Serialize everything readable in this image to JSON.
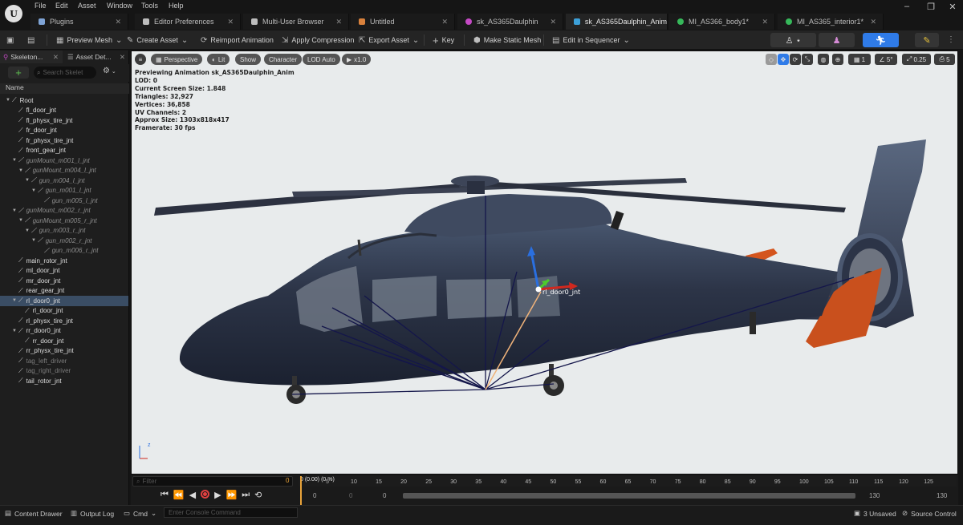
{
  "menu": [
    "File",
    "Edit",
    "Asset",
    "Window",
    "Tools",
    "Help"
  ],
  "tabs": [
    {
      "label": "Plugins",
      "icon": "plugin-icon",
      "color": "#7fa4d6"
    },
    {
      "label": "Editor Preferences",
      "icon": "sliders-icon",
      "color": "#bdbdbd"
    },
    {
      "label": "Multi-User Browser",
      "icon": "monitor-icon",
      "color": "#bdbdbd"
    },
    {
      "label": "Untitled",
      "icon": "level-icon",
      "color": "#d9813c"
    },
    {
      "label": "sk_AS365Daulphin",
      "icon": "skeleton-icon",
      "color": "#c64ac6"
    },
    {
      "label": "sk_AS365Daulphin_Anim",
      "icon": "animation-icon",
      "color": "#3ca0d9"
    },
    {
      "label": "MI_AS366_body1*",
      "icon": "material-icon",
      "color": "#36b85a"
    },
    {
      "label": "MI_AS365_interior1*",
      "icon": "material-icon",
      "color": "#36b85a"
    }
  ],
  "toolbar": {
    "preview_mesh": "Preview Mesh",
    "create_asset": "Create Asset",
    "reimport_animation": "Reimport Animation",
    "apply_compression": "Apply Compression",
    "export_asset": "Export Asset",
    "key": "Key",
    "make_static_mesh": "Make Static Mesh",
    "edit_in_sequencer": "Edit in Sequencer"
  },
  "left_panel": {
    "tab_skeleton": "Skeleton...",
    "tab_asset_details": "Asset Det...",
    "search_placeholder": "Search Skelet",
    "column_name": "Name",
    "bones": [
      {
        "label": "Root",
        "depth": 0,
        "arrow": true,
        "style": "normal"
      },
      {
        "label": "fl_door_jnt",
        "depth": 1,
        "arrow": false,
        "style": "normal"
      },
      {
        "label": "fl_physx_tire_jnt",
        "depth": 1,
        "arrow": false,
        "style": "normal"
      },
      {
        "label": "fr_door_jnt",
        "depth": 1,
        "arrow": false,
        "style": "normal"
      },
      {
        "label": "fr_physx_tire_jnt",
        "depth": 1,
        "arrow": false,
        "style": "normal"
      },
      {
        "label": "front_gear_jnt",
        "depth": 1,
        "arrow": false,
        "style": "normal"
      },
      {
        "label": "gunMount_m001_l_jnt",
        "depth": 1,
        "arrow": true,
        "style": "dim"
      },
      {
        "label": "gunMount_m004_l_jnt",
        "depth": 2,
        "arrow": true,
        "style": "dim"
      },
      {
        "label": "gun_m004_l_jnt",
        "depth": 3,
        "arrow": true,
        "style": "dim"
      },
      {
        "label": "gun_m001_l_jnt",
        "depth": 4,
        "arrow": true,
        "style": "dim"
      },
      {
        "label": "gun_m005_l_jnt",
        "depth": 5,
        "arrow": false,
        "style": "dim"
      },
      {
        "label": "gunMount_m002_r_jnt",
        "depth": 1,
        "arrow": true,
        "style": "dim"
      },
      {
        "label": "gunMount_m005_r_jnt",
        "depth": 2,
        "arrow": true,
        "style": "dim"
      },
      {
        "label": "gun_m003_r_jnt",
        "depth": 3,
        "arrow": true,
        "style": "dim"
      },
      {
        "label": "gun_m002_r_jnt",
        "depth": 4,
        "arrow": true,
        "style": "dim"
      },
      {
        "label": "gun_m006_r_jnt",
        "depth": 5,
        "arrow": false,
        "style": "dim"
      },
      {
        "label": "main_rotor_jnt",
        "depth": 1,
        "arrow": false,
        "style": "normal"
      },
      {
        "label": "ml_door_jnt",
        "depth": 1,
        "arrow": false,
        "style": "normal"
      },
      {
        "label": "mr_door_jnt",
        "depth": 1,
        "arrow": false,
        "style": "normal"
      },
      {
        "label": "rear_gear_jnt",
        "depth": 1,
        "arrow": false,
        "style": "normal"
      },
      {
        "label": "rl_door0_jnt",
        "depth": 1,
        "arrow": true,
        "style": "selected"
      },
      {
        "label": "rl_door_jnt",
        "depth": 2,
        "arrow": false,
        "style": "normal"
      },
      {
        "label": "rl_physx_tire_jnt",
        "depth": 1,
        "arrow": false,
        "style": "normal"
      },
      {
        "label": "rr_door0_jnt",
        "depth": 1,
        "arrow": true,
        "style": "normal"
      },
      {
        "label": "rr_door_jnt",
        "depth": 2,
        "arrow": false,
        "style": "normal"
      },
      {
        "label": "rr_physx_tire_jnt",
        "depth": 1,
        "arrow": false,
        "style": "normal"
      },
      {
        "label": "tag_left_driver",
        "depth": 1,
        "arrow": false,
        "style": "gray"
      },
      {
        "label": "tag_right_driver",
        "depth": 1,
        "arrow": false,
        "style": "gray"
      },
      {
        "label": "tail_rotor_jnt",
        "depth": 1,
        "arrow": false,
        "style": "normal"
      }
    ]
  },
  "viewport": {
    "perspective": "Perspective",
    "lit": "Lit",
    "show": "Show",
    "character": "Character",
    "lod_auto": "LOD Auto",
    "play_rate": "x1.0",
    "grid_value": "1",
    "angle_value": "5°",
    "scale_value": "0.25",
    "camera_speed": "5",
    "info_lines": [
      "Previewing Animation sk_AS365Daulphin_Anim",
      "LOD: 0",
      "Current Screen Size: 1.848",
      "Triangles: 32,927",
      "Vertices: 36,858",
      "UV Channels: 2",
      "Approx Size: 1303x818x417",
      "Framerate: 30 fps"
    ],
    "joint_label": "rl_door0_jnt",
    "axis_z": "z"
  },
  "timeline": {
    "filter_placeholder": "Filter",
    "filter_value": "0",
    "current": "0 (0.00) (0 %)",
    "ticks": [
      "5",
      "10",
      "15",
      "20",
      "25",
      "30",
      "35",
      "40",
      "45",
      "50",
      "55",
      "60",
      "65",
      "70",
      "75",
      "80",
      "85",
      "90",
      "95",
      "100",
      "105",
      "110",
      "115",
      "120",
      "125"
    ],
    "start_a": "0",
    "start_b": "0",
    "start_c": "0",
    "end_a": "130",
    "end_b": "130"
  },
  "statusbar": {
    "content_drawer": "Content Drawer",
    "output_log": "Output Log",
    "cmd": "Cmd",
    "console_placeholder": "Enter Console Command",
    "unsaved": "3 Unsaved",
    "source_control": "Source Control"
  }
}
